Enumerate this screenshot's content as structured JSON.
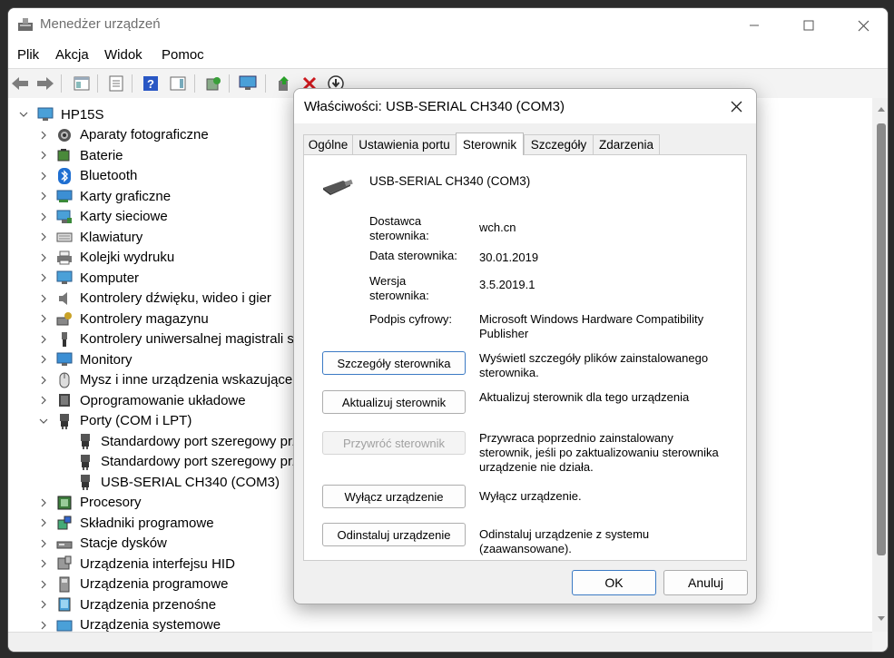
{
  "window": {
    "title": "Menedżer urządzeń"
  },
  "menu": [
    "Plik",
    "Akcja",
    "Widok",
    "Pomoc"
  ],
  "tree": {
    "root": "HP15S",
    "items": [
      {
        "label": "Aparaty fotograficzne",
        "icon": "camera-icon"
      },
      {
        "label": "Baterie",
        "icon": "battery-icon"
      },
      {
        "label": "Bluetooth",
        "icon": "bluetooth-icon"
      },
      {
        "label": "Karty graficzne",
        "icon": "display-adapter-icon"
      },
      {
        "label": "Karty sieciowe",
        "icon": "network-adapter-icon"
      },
      {
        "label": "Klawiatury",
        "icon": "keyboard-icon"
      },
      {
        "label": "Kolejki wydruku",
        "icon": "printer-icon"
      },
      {
        "label": "Komputer",
        "icon": "computer-icon"
      },
      {
        "label": "Kontrolery dźwięku, wideo i gier",
        "icon": "speaker-icon"
      },
      {
        "label": "Kontrolery magazynu",
        "icon": "storage-controller-icon"
      },
      {
        "label": "Kontrolery uniwersalnej magistrali sz",
        "icon": "usb-icon"
      },
      {
        "label": "Monitory",
        "icon": "monitor-icon"
      },
      {
        "label": "Mysz i inne urządzenia wskazujące",
        "icon": "mouse-icon"
      },
      {
        "label": "Oprogramowanie układowe",
        "icon": "firmware-icon"
      },
      {
        "label": "Porty (COM i LPT)",
        "icon": "port-icon",
        "expanded": true
      },
      {
        "label": "Standardowy port szeregowy prze",
        "icon": "port-icon",
        "child": true
      },
      {
        "label": "Standardowy port szeregowy prze",
        "icon": "port-icon",
        "child": true
      },
      {
        "label": "USB-SERIAL CH340 (COM3)",
        "icon": "port-icon",
        "child": true
      },
      {
        "label": "Procesory",
        "icon": "processor-icon"
      },
      {
        "label": "Składniki programowe",
        "icon": "software-component-icon"
      },
      {
        "label": "Stacje dysków",
        "icon": "disk-drive-icon"
      },
      {
        "label": "Urządzenia interfejsu HID",
        "icon": "hid-icon"
      },
      {
        "label": "Urządzenia programowe",
        "icon": "software-device-icon"
      },
      {
        "label": "Urządzenia przenośne",
        "icon": "portable-device-icon"
      },
      {
        "label": "Urządzenia systemowe",
        "icon": "system-device-icon"
      }
    ]
  },
  "dialog": {
    "title": "Właściwości: USB-SERIAL CH340 (COM3)",
    "tabs": [
      "Ogólne",
      "Ustawienia portu",
      "Sterownik",
      "Szczegóły",
      "Zdarzenia"
    ],
    "active_tab": "Sterownik",
    "device_name": "USB-SERIAL CH340 (COM3)",
    "fields": {
      "provider_label": "Dostawca sterownika:",
      "provider_value": "wch.cn",
      "date_label": "Data sterownika:",
      "date_value": "30.01.2019",
      "version_label": "Wersja sterownika:",
      "version_value": "3.5.2019.1",
      "signer_label": "Podpis cyfrowy:",
      "signer_value": "Microsoft Windows Hardware Compatibility Publisher"
    },
    "actions": [
      {
        "button": "Szczegóły sterownika",
        "desc": "Wyświetl szczegóły plików zainstalowanego sterownika.",
        "disabled": false
      },
      {
        "button": "Aktualizuj sterownik",
        "desc": "Aktualizuj sterownik dla tego urządzenia",
        "disabled": false
      },
      {
        "button": "Przywróć sterownik",
        "desc": "Przywraca poprzednio zainstalowany sterownik, jeśli po zaktualizowaniu sterownika urządzenie nie działa.",
        "disabled": true
      },
      {
        "button": "Wyłącz urządzenie",
        "desc": "Wyłącz urządzenie.",
        "disabled": false
      },
      {
        "button": "Odinstaluj urządzenie",
        "desc": "Odinstaluj urządzenie z systemu (zaawansowane).",
        "disabled": false
      }
    ],
    "ok_label": "OK",
    "cancel_label": "Anuluj"
  }
}
